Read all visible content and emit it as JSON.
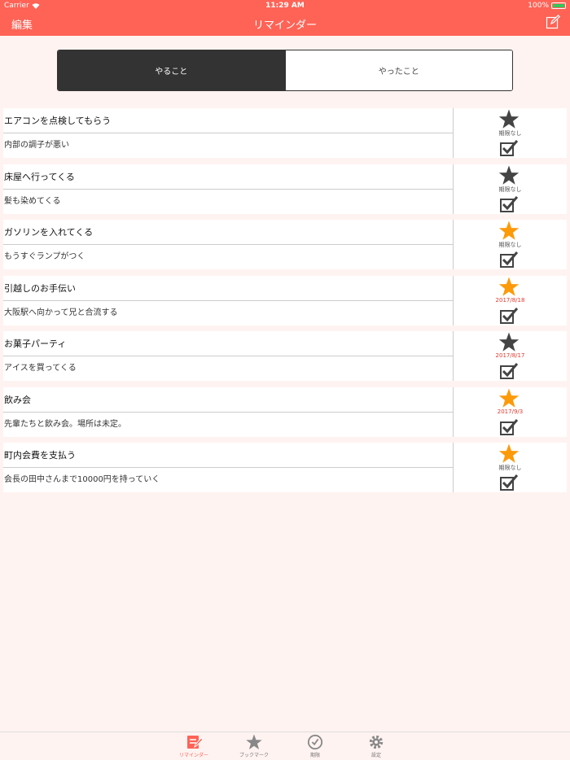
{
  "status": {
    "carrier": "Carrier",
    "time": "11:29 AM",
    "battery": "100%"
  },
  "nav": {
    "left": "編集",
    "title": "リマインダー",
    "right_icon": "compose-icon"
  },
  "segment": {
    "active": "やること",
    "inactive": "やったこと"
  },
  "items": [
    {
      "title": "エアコンを点検してもらう",
      "note": "内部の調子が悪い",
      "starred": false,
      "due": "期限なし",
      "overdue": false
    },
    {
      "title": "床屋へ行ってくる",
      "note": "髪も染めてくる",
      "starred": false,
      "due": "期限なし",
      "overdue": false
    },
    {
      "title": "ガソリンを入れてくる",
      "note": "もうすぐランプがつく",
      "starred": true,
      "due": "期限なし",
      "overdue": false
    },
    {
      "title": "引越しのお手伝い",
      "note": "大阪駅へ向かって兄と合流する",
      "starred": true,
      "due": "2017/8/18",
      "overdue": true
    },
    {
      "title": "お菓子パーティ",
      "note": "アイスを買ってくる",
      "starred": false,
      "due": "2017/8/17",
      "overdue": true
    },
    {
      "title": "飲み会",
      "note": "先輩たちと飲み会。場所は未定。",
      "starred": true,
      "due": "2017/9/3",
      "overdue": true
    },
    {
      "title": "町内会費を支払う",
      "note": "会長の田中さんまで10000円を持っていく",
      "starred": true,
      "due": "期限なし",
      "overdue": false
    }
  ],
  "tabs": [
    {
      "label": "リマインダー",
      "icon": "reminder-icon",
      "active": true
    },
    {
      "label": "ブックマーク",
      "icon": "star-icon",
      "active": false
    },
    {
      "label": "期限",
      "icon": "clock-icon",
      "active": false
    },
    {
      "label": "設定",
      "icon": "gear-icon",
      "active": false
    }
  ],
  "colors": {
    "accent": "#fe6356",
    "star_on": "#fd9a0a",
    "star_off": "#444444",
    "overdue": "#e0392c",
    "background": "#fff3f1"
  }
}
